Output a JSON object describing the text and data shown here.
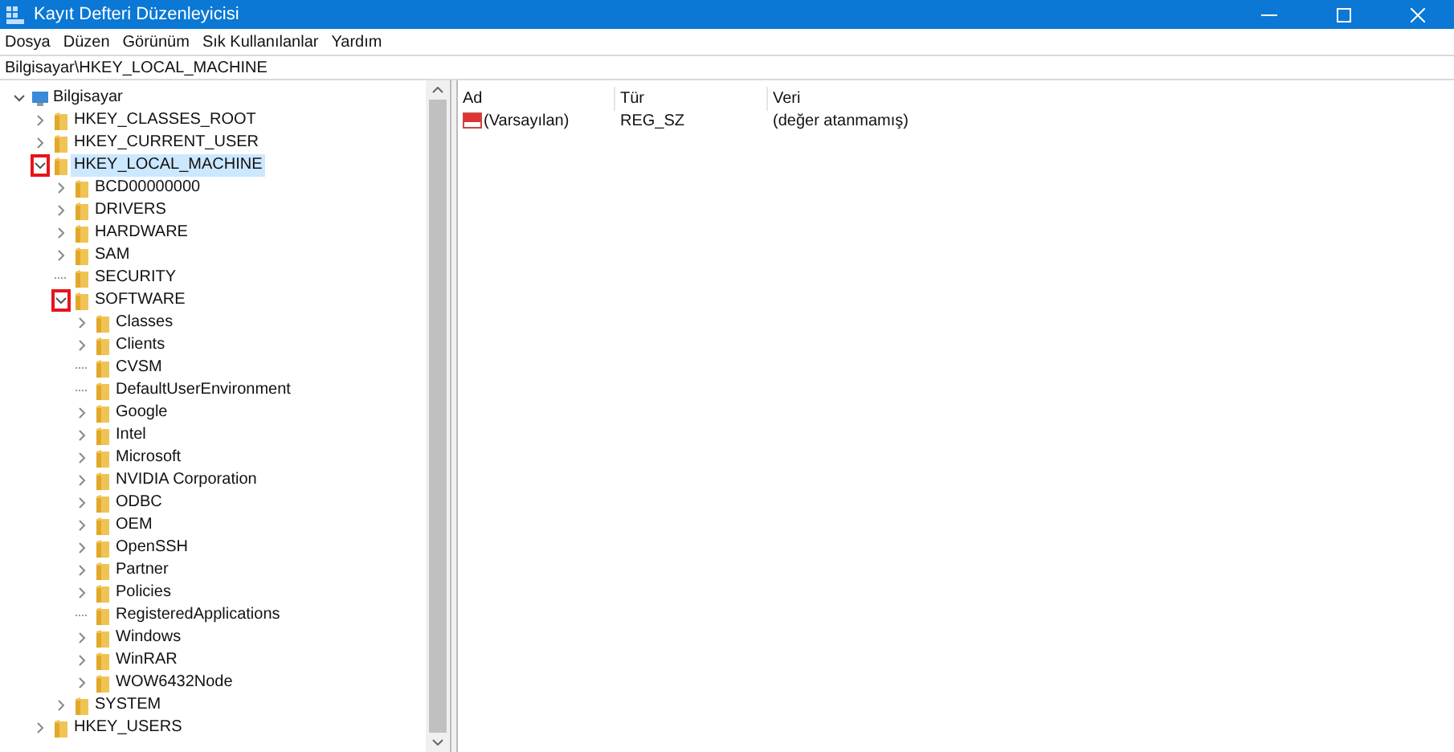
{
  "window": {
    "title": "Kayıt Defteri Düzenleyicisi"
  },
  "menu": [
    "Dosya",
    "Düzen",
    "Görünüm",
    "Sık Kullanılanlar",
    "Yardım"
  ],
  "address": "Bilgisayar\\HKEY_LOCAL_MACHINE",
  "tree": [
    {
      "label": "Bilgisayar",
      "kind": "computer",
      "expandable": true,
      "expanded": true,
      "selected": false,
      "marked": false,
      "children": [
        {
          "label": "HKEY_CLASSES_ROOT",
          "kind": "folder",
          "expandable": true,
          "expanded": false,
          "selected": false,
          "marked": false
        },
        {
          "label": "HKEY_CURRENT_USER",
          "kind": "folder",
          "expandable": true,
          "expanded": false,
          "selected": false,
          "marked": false
        },
        {
          "label": "HKEY_LOCAL_MACHINE",
          "kind": "folder",
          "expandable": true,
          "expanded": true,
          "selected": true,
          "marked": true,
          "children": [
            {
              "label": "BCD00000000",
              "kind": "folder",
              "expandable": true,
              "expanded": false,
              "selected": false,
              "marked": false
            },
            {
              "label": "DRIVERS",
              "kind": "folder",
              "expandable": true,
              "expanded": false,
              "selected": false,
              "marked": false
            },
            {
              "label": "HARDWARE",
              "kind": "folder",
              "expandable": true,
              "expanded": false,
              "selected": false,
              "marked": false
            },
            {
              "label": "SAM",
              "kind": "folder",
              "expandable": true,
              "expanded": false,
              "selected": false,
              "marked": false
            },
            {
              "label": "SECURITY",
              "kind": "folder",
              "expandable": false,
              "expanded": false,
              "selected": false,
              "marked": false
            },
            {
              "label": "SOFTWARE",
              "kind": "folder",
              "expandable": true,
              "expanded": true,
              "selected": false,
              "marked": true,
              "children": [
                {
                  "label": "Classes",
                  "kind": "folder",
                  "expandable": true,
                  "expanded": false,
                  "selected": false,
                  "marked": false
                },
                {
                  "label": "Clients",
                  "kind": "folder",
                  "expandable": true,
                  "expanded": false,
                  "selected": false,
                  "marked": false
                },
                {
                  "label": "CVSM",
                  "kind": "folder",
                  "expandable": false,
                  "expanded": false,
                  "selected": false,
                  "marked": false
                },
                {
                  "label": "DefaultUserEnvironment",
                  "kind": "folder",
                  "expandable": false,
                  "expanded": false,
                  "selected": false,
                  "marked": false
                },
                {
                  "label": "Google",
                  "kind": "folder",
                  "expandable": true,
                  "expanded": false,
                  "selected": false,
                  "marked": false
                },
                {
                  "label": "Intel",
                  "kind": "folder",
                  "expandable": true,
                  "expanded": false,
                  "selected": false,
                  "marked": false
                },
                {
                  "label": "Microsoft",
                  "kind": "folder",
                  "expandable": true,
                  "expanded": false,
                  "selected": false,
                  "marked": false
                },
                {
                  "label": "NVIDIA Corporation",
                  "kind": "folder",
                  "expandable": true,
                  "expanded": false,
                  "selected": false,
                  "marked": false
                },
                {
                  "label": "ODBC",
                  "kind": "folder",
                  "expandable": true,
                  "expanded": false,
                  "selected": false,
                  "marked": false
                },
                {
                  "label": "OEM",
                  "kind": "folder",
                  "expandable": true,
                  "expanded": false,
                  "selected": false,
                  "marked": false
                },
                {
                  "label": "OpenSSH",
                  "kind": "folder",
                  "expandable": true,
                  "expanded": false,
                  "selected": false,
                  "marked": false
                },
                {
                  "label": "Partner",
                  "kind": "folder",
                  "expandable": true,
                  "expanded": false,
                  "selected": false,
                  "marked": false
                },
                {
                  "label": "Policies",
                  "kind": "folder",
                  "expandable": true,
                  "expanded": false,
                  "selected": false,
                  "marked": false
                },
                {
                  "label": "RegisteredApplications",
                  "kind": "folder",
                  "expandable": false,
                  "expanded": false,
                  "selected": false,
                  "marked": false
                },
                {
                  "label": "Windows",
                  "kind": "folder",
                  "expandable": true,
                  "expanded": false,
                  "selected": false,
                  "marked": false
                },
                {
                  "label": "WinRAR",
                  "kind": "folder",
                  "expandable": true,
                  "expanded": false,
                  "selected": false,
                  "marked": false
                },
                {
                  "label": "WOW6432Node",
                  "kind": "folder",
                  "expandable": true,
                  "expanded": false,
                  "selected": false,
                  "marked": false
                }
              ]
            },
            {
              "label": "SYSTEM",
              "kind": "folder",
              "expandable": true,
              "expanded": false,
              "selected": false,
              "marked": false
            }
          ]
        },
        {
          "label": "HKEY_USERS",
          "kind": "folder",
          "expandable": true,
          "expanded": false,
          "selected": false,
          "marked": false
        }
      ]
    }
  ],
  "table": {
    "columns": [
      "Ad",
      "Tür",
      "Veri"
    ],
    "rows": [
      {
        "name": "(Varsayılan)",
        "type": "REG_SZ",
        "data": "(değer atanmamış)"
      }
    ]
  }
}
